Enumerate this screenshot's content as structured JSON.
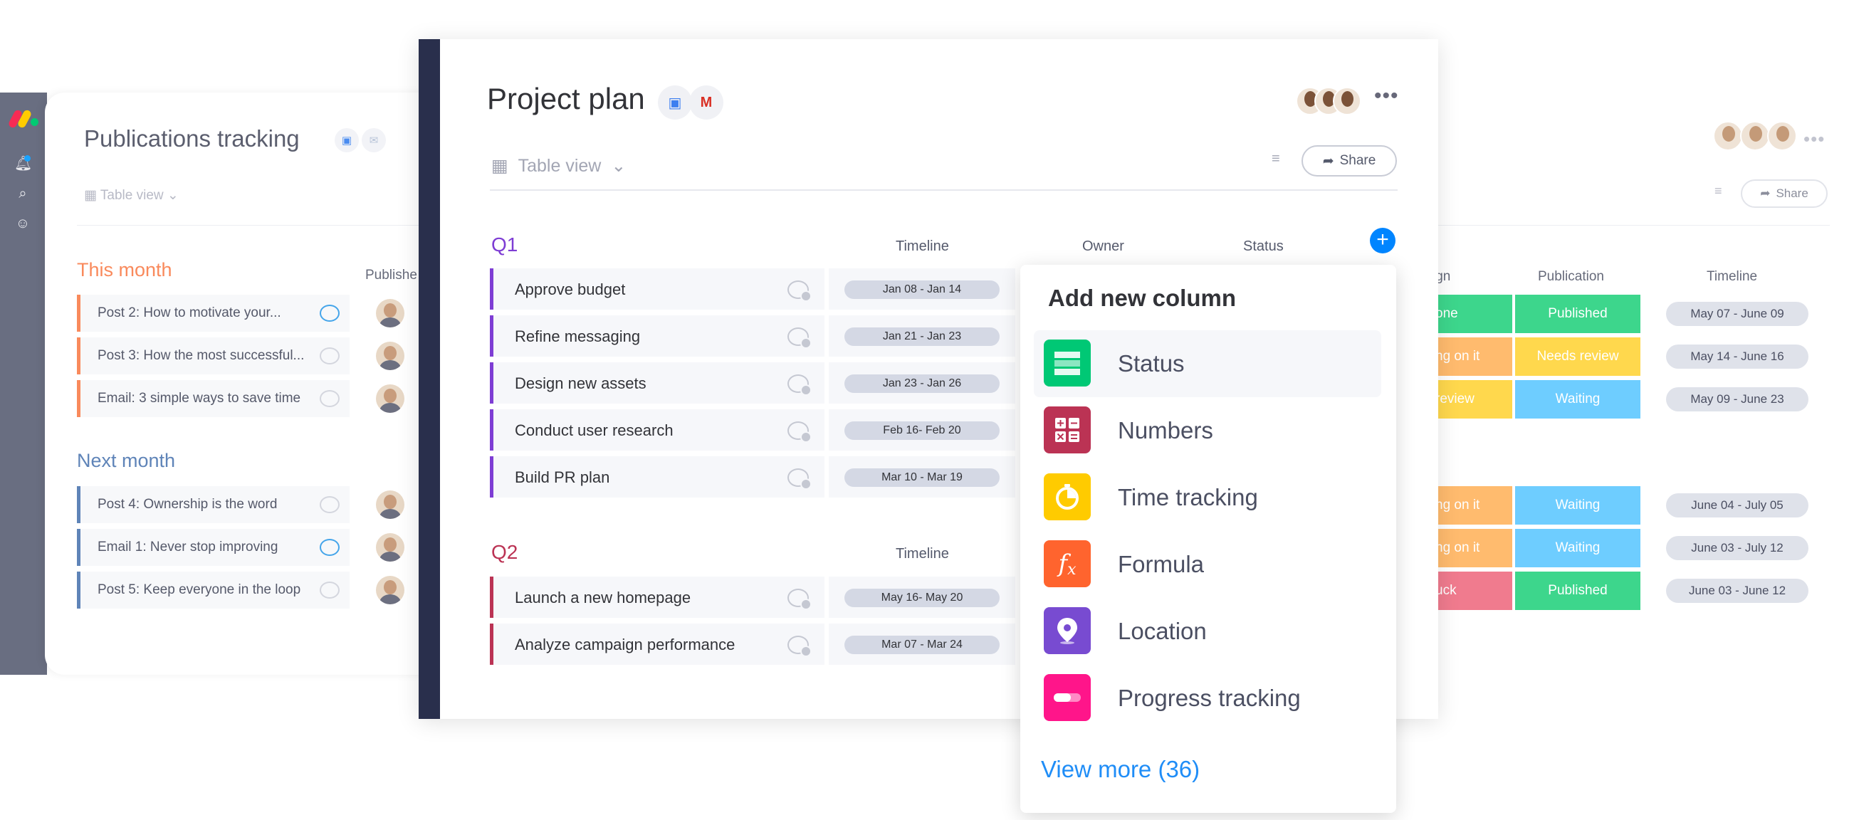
{
  "background_left": {
    "title": "Publications tracking",
    "view_label": "Table view",
    "published_col": "Publishe",
    "groups": [
      {
        "label": "This month",
        "color": "#f98a5c",
        "rows": [
          {
            "title": "Post 2: How to motivate your...",
            "comment_active": true
          },
          {
            "title": "Post 3: How the most successful...",
            "comment_active": false
          },
          {
            "title": "Email: 3 simple ways to save time",
            "comment_active": false
          }
        ]
      },
      {
        "label": "Next month",
        "color": "#5f84b8",
        "rows": [
          {
            "title": "Post 4: Ownership is the word",
            "comment_active": false
          },
          {
            "title": "Email 1: Never stop improving",
            "comment_active": true
          },
          {
            "title": "Post 5: Keep everyone in the loop",
            "comment_active": false
          }
        ]
      }
    ]
  },
  "background_right": {
    "share_label": "Share",
    "columns": {
      "design": "ign",
      "publication": "Publication",
      "timeline": "Timeline"
    },
    "rows": [
      {
        "design": "one",
        "design_color": "#3dd68c",
        "publication": "Published",
        "publication_color": "#3dd68c",
        "timeline": "May 07 - June 09"
      },
      {
        "design": "ng on it",
        "design_color": "#ffbb6e",
        "publication": "Needs review",
        "publication_color": "#ffd84d",
        "timeline": "May 14 - June 16"
      },
      {
        "design": "review",
        "design_color": "#ffd84d",
        "publication": "Waiting",
        "publication_color": "#6ecdff",
        "timeline": "May 09 - June 23"
      },
      {
        "design": "ng on it",
        "design_color": "#ffbb6e",
        "publication": "Waiting",
        "publication_color": "#6ecdff",
        "timeline": "June 04 - July 05"
      },
      {
        "design": "ng on it",
        "design_color": "#ffbb6e",
        "publication": "Waiting",
        "publication_color": "#6ecdff",
        "timeline": "June 03 - July 12"
      },
      {
        "design": "uck",
        "design_color": "#f07b8e",
        "publication": "Published",
        "publication_color": "#3dd68c",
        "timeline": "June 03 - June 12"
      }
    ]
  },
  "main": {
    "title": "Project plan",
    "view_label": "Table view",
    "share_label": "Share",
    "columns": {
      "timeline": "Timeline",
      "owner": "Owner",
      "status": "Status"
    },
    "groups": [
      {
        "label": "Q1",
        "color": "#7e3dd4",
        "rows": [
          {
            "title": "Approve budget",
            "timeline": "Jan 08 - Jan 14"
          },
          {
            "title": "Refine messaging",
            "timeline": "Jan 21 - Jan 23"
          },
          {
            "title": "Design new assets",
            "timeline": "Jan 23 - Jan 26"
          },
          {
            "title": "Conduct user research",
            "timeline": "Feb 16- Feb 20"
          },
          {
            "title": "Build PR plan",
            "timeline": "Mar 10 - Mar 19"
          }
        ]
      },
      {
        "label": "Q2",
        "color": "#bb3354",
        "rows": [
          {
            "title": "Launch a new homepage",
            "timeline": "May 16- May 20"
          },
          {
            "title": "Analyze campaign performance",
            "timeline": "Mar 07 - Mar 24"
          }
        ]
      }
    ]
  },
  "dropdown": {
    "title": "Add new column",
    "items": [
      {
        "label": "Status",
        "icon": "status-icon",
        "color": "#00c875"
      },
      {
        "label": "Numbers",
        "icon": "numbers-icon",
        "color": "#bb3354"
      },
      {
        "label": "Time tracking",
        "icon": "time-tracking-icon",
        "color": "#ffcb00"
      },
      {
        "label": "Formula",
        "icon": "formula-icon",
        "color": "#ff642e"
      },
      {
        "label": "Location",
        "icon": "location-icon",
        "color": "#784bd1"
      },
      {
        "label": "Progress tracking",
        "icon": "progress-icon",
        "color": "#ff158a"
      }
    ],
    "view_more": "View more (36)"
  }
}
